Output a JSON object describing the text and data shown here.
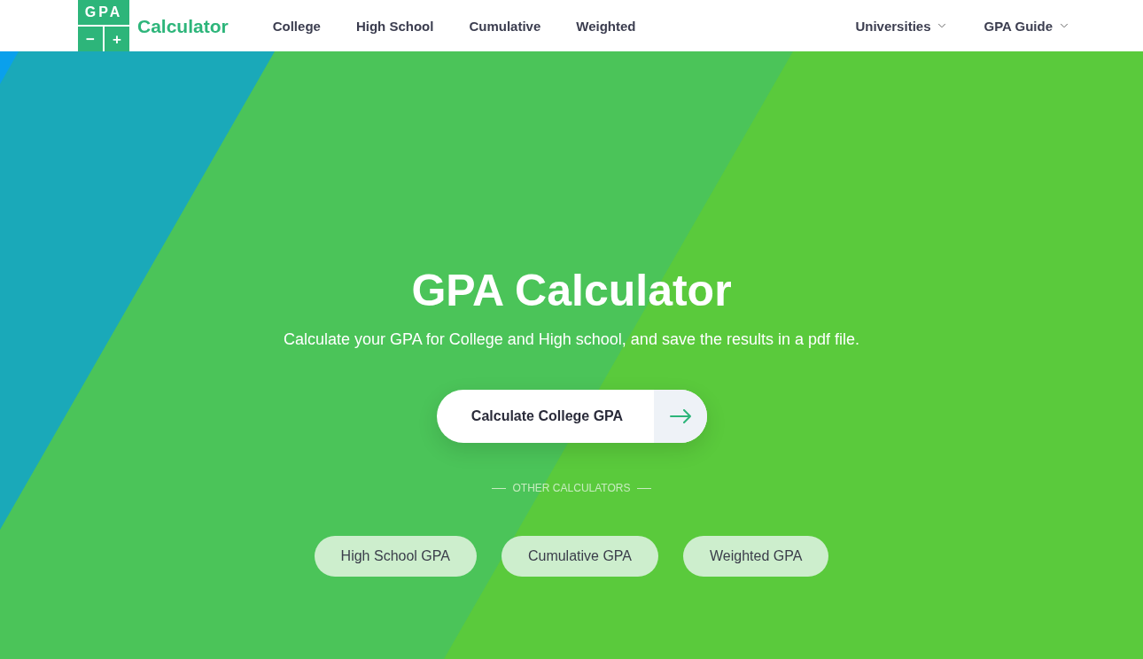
{
  "header": {
    "logo": {
      "top": "GPA",
      "minus": "−",
      "plus": "+",
      "wordmark": "Calculator"
    },
    "nav_links": [
      "College",
      "High School",
      "Cumulative",
      "Weighted"
    ],
    "dropdown_menus": [
      {
        "label": "Universities"
      },
      {
        "label": "GPA Guide"
      }
    ]
  },
  "hero": {
    "title": "GPA Calculator",
    "subtitle": "Calculate your GPA for College and High school, and save the results in a pdf file.",
    "primary_button": {
      "label": "Calculate College GPA"
    },
    "section_label": "OTHER CALCULATORS",
    "calculator_links": [
      "High School GPA",
      "Cumulative GPA",
      "Weighted GPA"
    ]
  }
}
